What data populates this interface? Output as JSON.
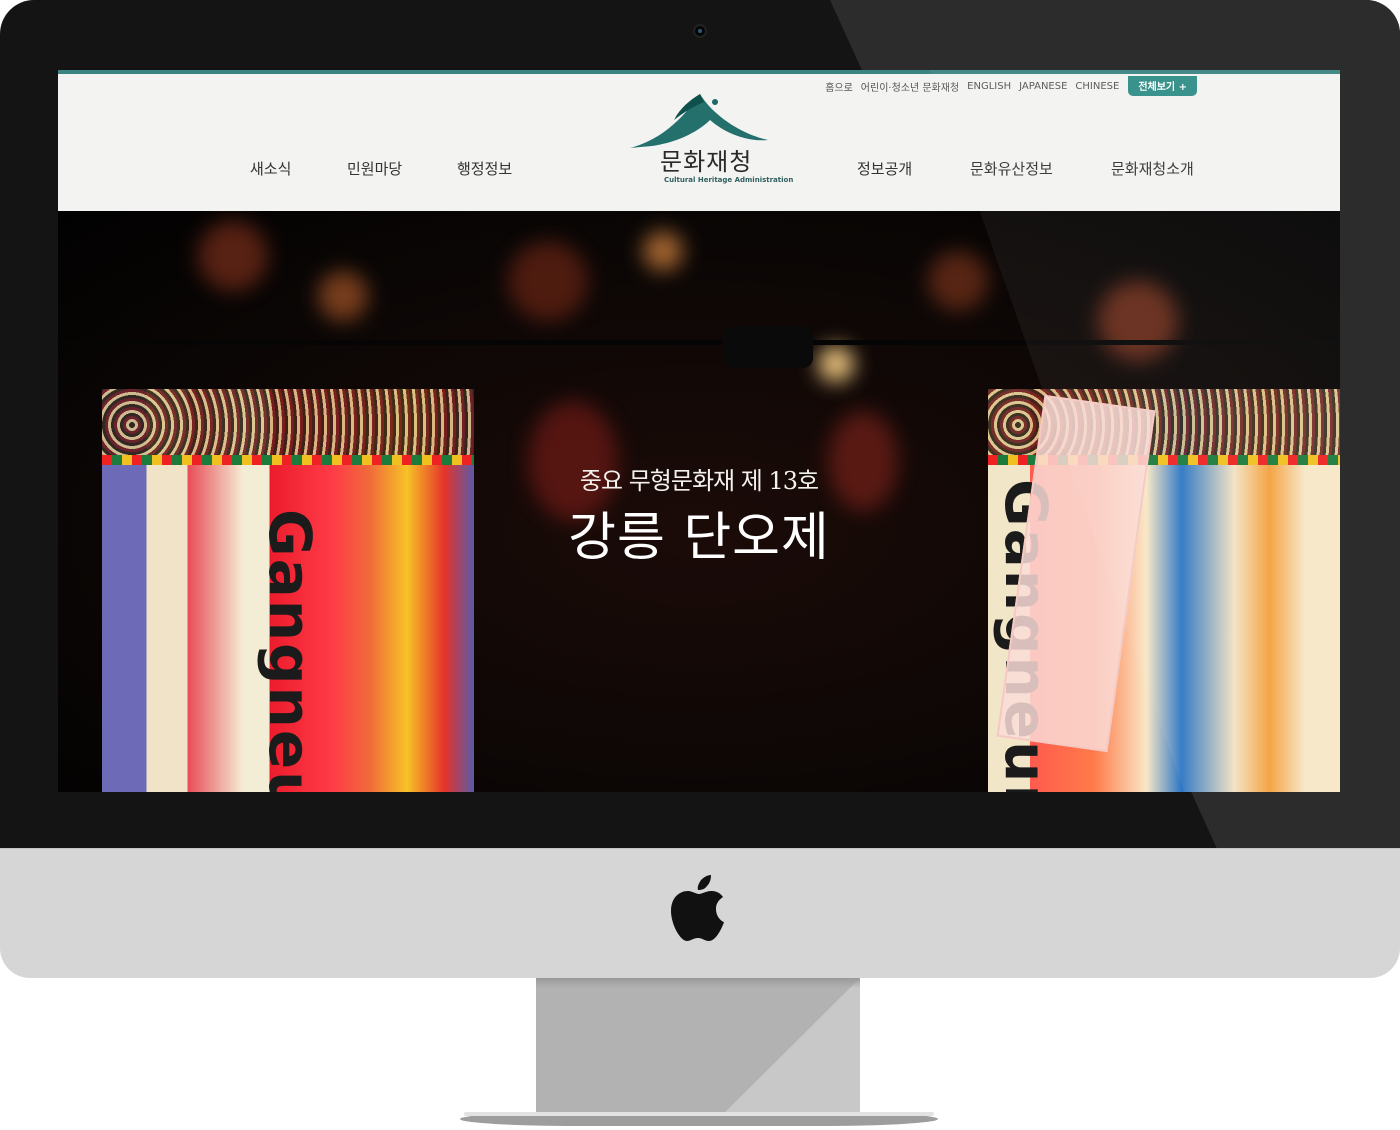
{
  "site": {
    "logo_title": "문화재청",
    "logo_subtitle": "Cultural Heritage Administration"
  },
  "utility_links": [
    "홈으로",
    "어린이·청소년 문화재청",
    "ENGLISH",
    "JAPANESE",
    "CHINESE"
  ],
  "view_all_button": "전체보기 +",
  "nav": {
    "left": [
      "새소식",
      "민원마당",
      "행정정보"
    ],
    "right": [
      "정보공개",
      "문화유산정보",
      "문화재청소개"
    ]
  },
  "hero": {
    "subtitle": "중요 무형문화재 제 13호",
    "title": "강릉 단오제",
    "lantern_text": "Gangneung"
  },
  "colors": {
    "accent": "#2f8d86",
    "header_bg": "#f3f3f1",
    "bezel": "#141414",
    "chin": "#d6d6d6"
  },
  "icons": {
    "apple": "apple-logo-icon",
    "camera": "camera-icon",
    "plus": "plus-icon"
  }
}
